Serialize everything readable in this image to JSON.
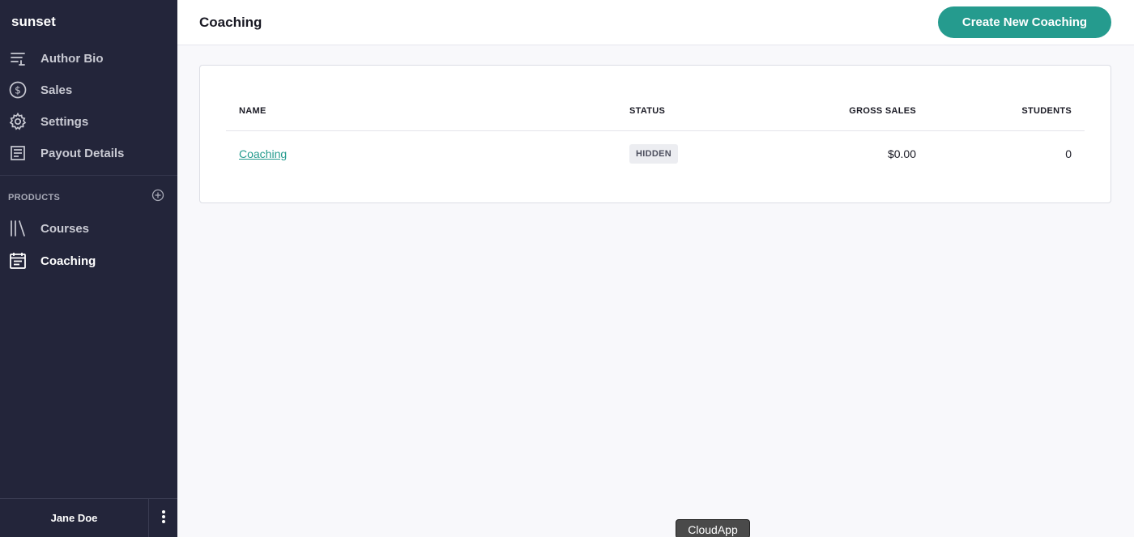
{
  "sidebar": {
    "brand": "sunset",
    "items": [
      {
        "label": "Author Bio",
        "icon": "list-icon"
      },
      {
        "label": "Sales",
        "icon": "dollar-icon"
      },
      {
        "label": "Settings",
        "icon": "gear-icon"
      },
      {
        "label": "Payout Details",
        "icon": "document-icon"
      }
    ],
    "products_section": {
      "label": "PRODUCTS",
      "add_icon": "plus-circle-icon",
      "items": [
        {
          "label": "Courses",
          "icon": "library-icon"
        },
        {
          "label": "Coaching",
          "icon": "calendar-icon",
          "active": true
        }
      ]
    },
    "user": {
      "name": "Jane Doe",
      "menu_icon": "kebab-icon"
    }
  },
  "header": {
    "title": "Coaching",
    "create_button": "Create New Coaching"
  },
  "table": {
    "columns": [
      "NAME",
      "STATUS",
      "GROSS SALES",
      "STUDENTS"
    ],
    "rows": [
      {
        "name": "Coaching",
        "status": "HIDDEN",
        "gross_sales": "$0.00",
        "students": "0"
      }
    ]
  },
  "overlay": {
    "cloudapp_label": "CloudApp"
  },
  "colors": {
    "sidebar_bg": "#23253a",
    "accent": "#259b8e",
    "page_bg": "#f8f8fb"
  }
}
